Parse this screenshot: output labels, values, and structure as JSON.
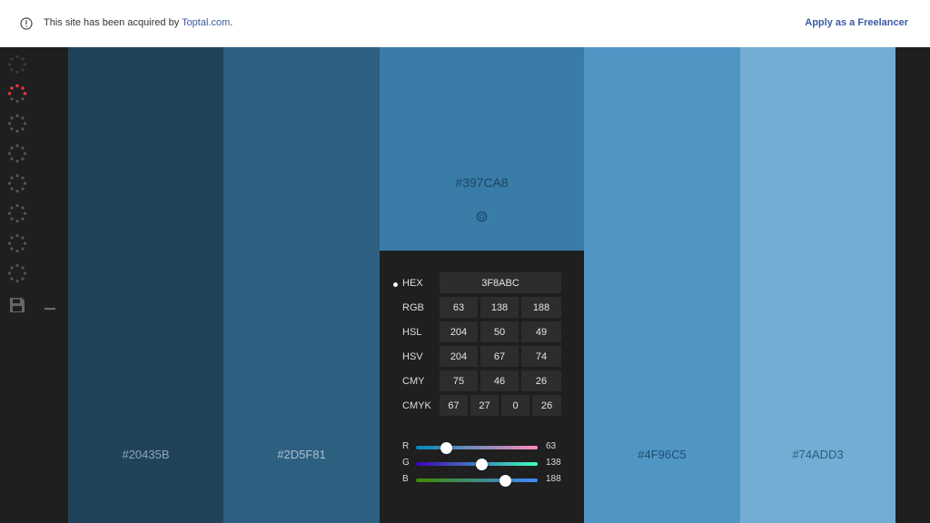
{
  "notice": {
    "text": "This site has been acquired by ",
    "link": "Toptal.com",
    "suffix": ".",
    "apply": "Apply as a Freelancer"
  },
  "palette": {
    "colors": [
      {
        "hex": "#20435B",
        "bg": "#20435b",
        "label_color": "#8fa3b3"
      },
      {
        "hex": "#2D5F81",
        "bg": "#2d5f81",
        "label_color": "#a9c0d2"
      },
      {
        "hex": "#397CA8",
        "bg": "#397ca8",
        "label_color": "#1d4462"
      },
      {
        "hex": "#4F96C5",
        "bg": "#4f96c5",
        "label_color": "#204e70"
      },
      {
        "hex": "#74ADD3",
        "bg": "#74add3",
        "label_color": "#2c5b80"
      }
    ]
  },
  "picker": {
    "hex_label": "HEX",
    "hex_value": "3F8ABC",
    "rows": [
      {
        "label": "RGB",
        "values": [
          "63",
          "138",
          "188"
        ]
      },
      {
        "label": "HSL",
        "values": [
          "204",
          "50",
          "49"
        ]
      },
      {
        "label": "HSV",
        "values": [
          "204",
          "67",
          "74"
        ]
      },
      {
        "label": "CMY",
        "values": [
          "75",
          "46",
          "26"
        ]
      },
      {
        "label": "CMYK",
        "values": [
          "67",
          "27",
          "0",
          "26"
        ]
      }
    ],
    "sliders": [
      {
        "label": "R",
        "value": "63",
        "fraction": 0.247
      },
      {
        "label": "G",
        "value": "138",
        "fraction": 0.541
      },
      {
        "label": "B",
        "value": "188",
        "fraction": 0.737
      }
    ]
  },
  "sidebar": {
    "icons": [
      "spinner-icon",
      "spinner-icon-active",
      "spinner-icon",
      "spinner-icon",
      "spinner-icon",
      "spinner-icon",
      "spinner-icon",
      "spinner-icon",
      "save-icon"
    ],
    "active_color": "#e03a3a"
  }
}
